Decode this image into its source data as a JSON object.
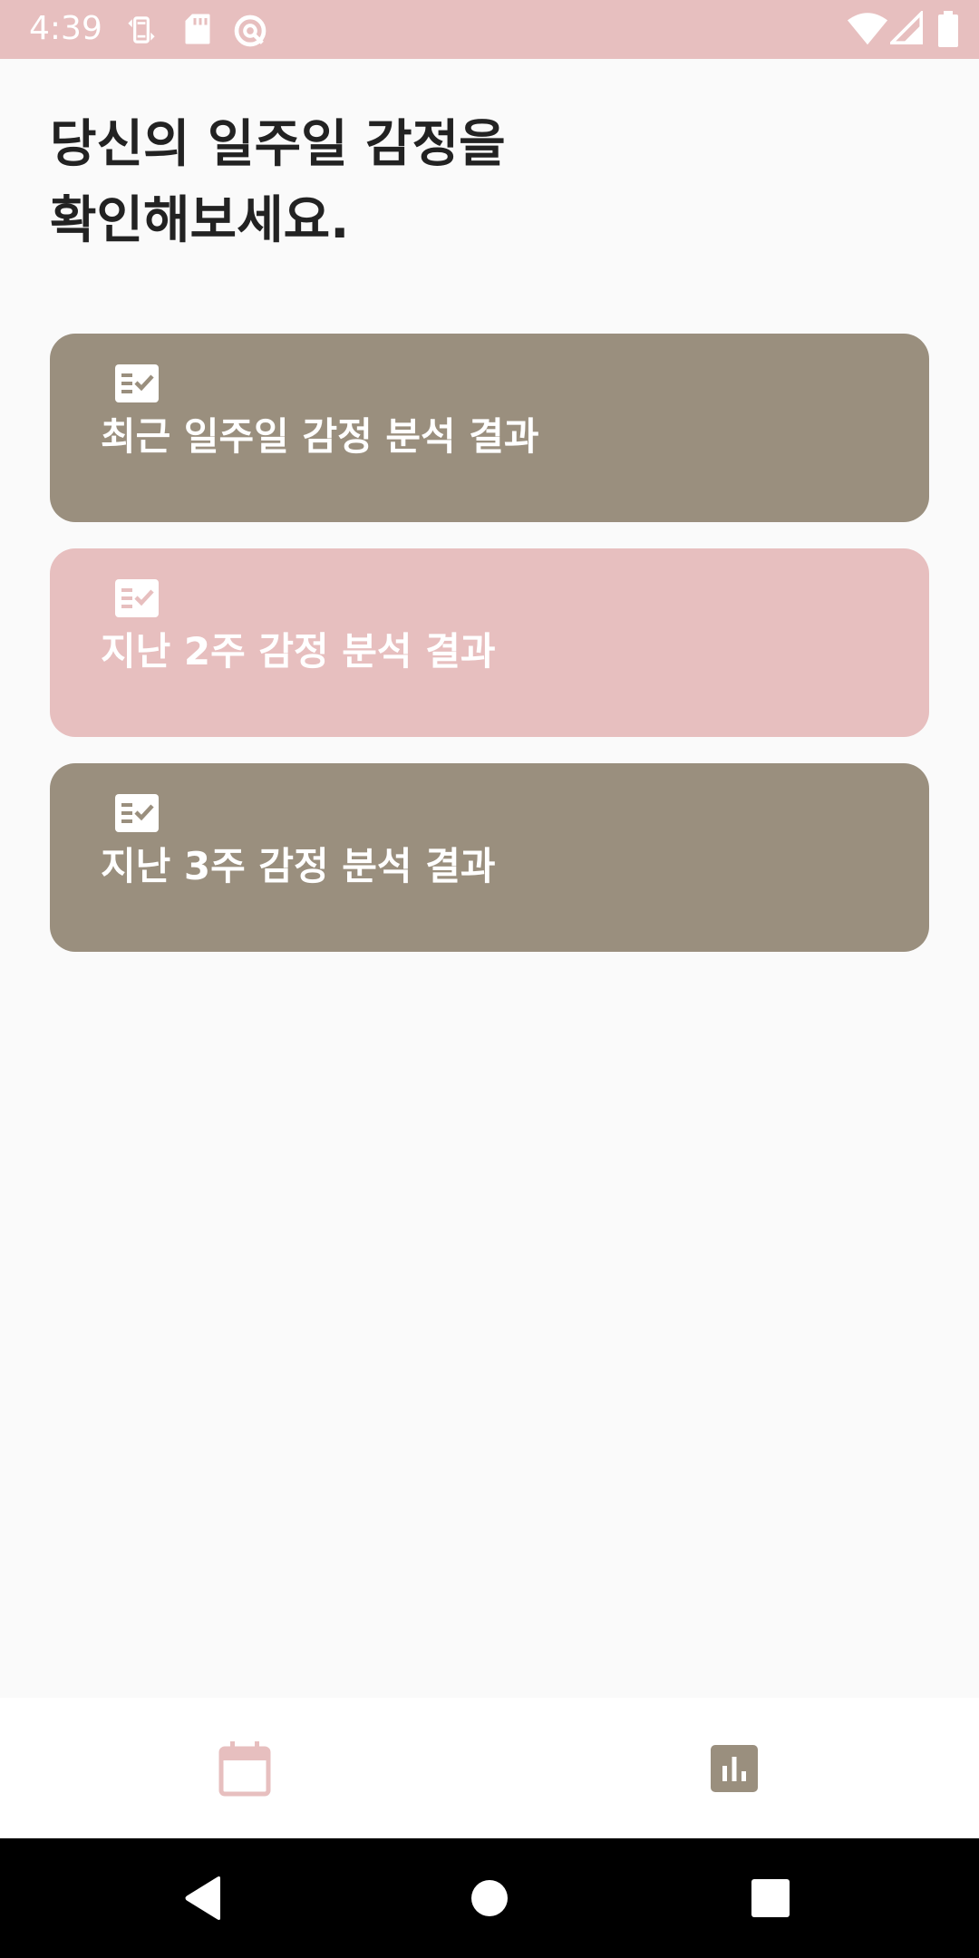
{
  "status_bar": {
    "time": "4:39",
    "background": "#e7bfbf",
    "left_icons": [
      "screen-rotation-icon",
      "sd-card-icon",
      "data-saver-icon"
    ],
    "right_icons": [
      "wifi-icon",
      "cellular-signal-icon",
      "battery-icon"
    ]
  },
  "header": {
    "title_line1": "당신의 일주일 감정을",
    "title_line2": "확인해보세요."
  },
  "cards": [
    {
      "label": "최근 일주일 감정 분석 결과",
      "color": "#9a8f7e",
      "icon": "checklist-icon"
    },
    {
      "label": "지난 2주 감정 분석 결과",
      "color": "#e7bfbf",
      "icon": "checklist-icon"
    },
    {
      "label": "지난 3주 감정 분석 결과",
      "color": "#9a8f7e",
      "icon": "checklist-icon"
    }
  ],
  "bottom_nav": {
    "items": [
      {
        "icon": "calendar-icon",
        "color": "#e7bfbf"
      },
      {
        "icon": "bar-chart-icon",
        "color": "#9a8f7e"
      }
    ]
  },
  "system_nav": {
    "items": [
      "back-icon",
      "home-icon",
      "recents-icon"
    ]
  }
}
